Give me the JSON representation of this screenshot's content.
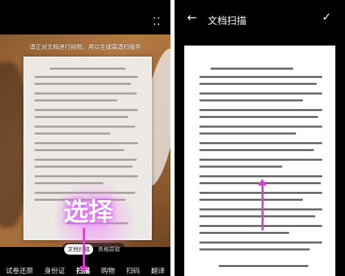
{
  "left": {
    "more_icon": "more-dots-icon",
    "hint": "请正对文档进行拍照，用以生成高清扫描件",
    "overlay_text": "选择",
    "sub_modes": [
      "文档扫描",
      "表格提取"
    ],
    "modes": [
      "试卷还原",
      "身份证",
      "扫描",
      "购物",
      "扫码",
      "翻译"
    ],
    "active_mode": "扫描"
  },
  "right": {
    "title": "文档扫描",
    "back_icon": "back-arrow-icon",
    "confirm_icon": "check-icon"
  },
  "colors": {
    "annotation": "#e23bdc",
    "background": "#000000"
  }
}
